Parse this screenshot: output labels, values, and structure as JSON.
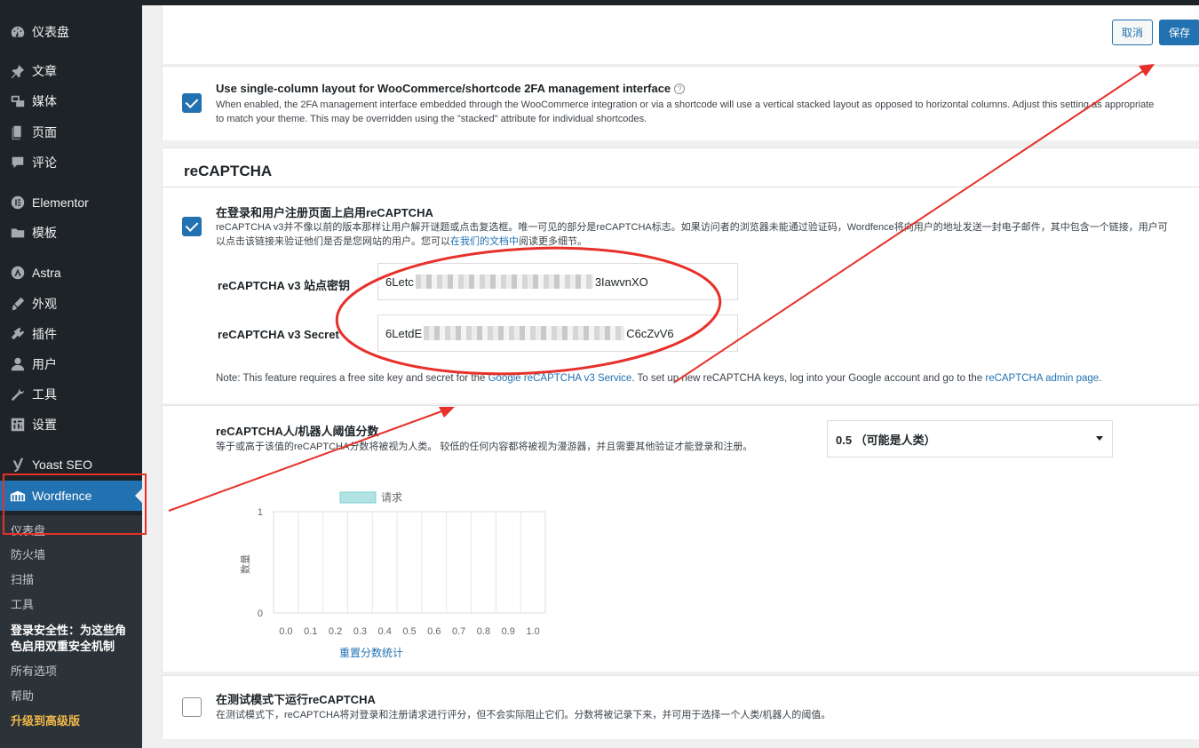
{
  "sidebar": {
    "items": [
      {
        "label": "仪表盘",
        "icon": "dashboard-icon"
      },
      {
        "label": "文章",
        "icon": "pin-icon"
      },
      {
        "label": "媒体",
        "icon": "media-icon"
      },
      {
        "label": "页面",
        "icon": "page-icon"
      },
      {
        "label": "评论",
        "icon": "comment-icon"
      },
      {
        "label": "Elementor",
        "icon": "elementor-icon"
      },
      {
        "label": "模板",
        "icon": "folder-icon"
      },
      {
        "label": "Astra",
        "icon": "astra-icon"
      },
      {
        "label": "外观",
        "icon": "brush-icon"
      },
      {
        "label": "插件",
        "icon": "plugin-icon"
      },
      {
        "label": "用户",
        "icon": "user-icon"
      },
      {
        "label": "工具",
        "icon": "wrench-icon"
      },
      {
        "label": "设置",
        "icon": "settings-icon"
      },
      {
        "label": "Yoast SEO",
        "icon": "yoast-icon"
      },
      {
        "label": "Wordfence",
        "icon": "wordfence-icon"
      }
    ],
    "submenu": [
      "仪表盘",
      "防火墙",
      "扫描",
      "工具",
      "登录安全性：为这些角色启用双重安全机制",
      "所有选项",
      "帮助",
      "升级到高级版"
    ]
  },
  "toolbar": {
    "cancel_label": "取消",
    "save_label": "保存"
  },
  "single_column": {
    "title": "Use single-column layout for WooCommerce/shortcode 2FA management interface",
    "help_glyph": "?",
    "desc": "When enabled, the 2FA management interface embedded through the WooCommerce integration or via a shortcode will use a vertical stacked layout as opposed to horizontal columns. Adjust this setting as appropriate to match your theme. This may be overridden using the \"stacked\" attribute for individual shortcodes.",
    "checked": true
  },
  "recaptcha": {
    "section_title": "reCAPTCHA",
    "enable_title": "在登录和用户注册页面上启用reCAPTCHA",
    "enable_desc_before": "reCAPTCHA v3并不像以前的版本那样让用户解开谜题或点击复选框。唯一可见的部分是reCAPTCHA标志。如果访问者的浏览器未能通过验证码，Wordfence将向用户的地址发送一封电子邮件，其中包含一个链接，用户可以点击该链接来验证他们是否是您网站的用户。您可以",
    "enable_desc_link": "在我们的文档中",
    "enable_desc_after": "阅读更多细节。",
    "site_key_label": "reCAPTCHA v3 站点密钥",
    "site_key_prefix": "6Letc",
    "site_key_suffix": "3IawvnXO",
    "secret_label": "reCAPTCHA v3 Secret",
    "secret_prefix": "6LetdE",
    "secret_suffix": "C6cZvV6",
    "note_before": "Note: This feature requires a free site key and secret for the ",
    "note_link1": "Google reCAPTCHA v3 Service",
    "note_middle": ". To set up new reCAPTCHA keys, log into your Google account and go to the ",
    "note_link2": "reCAPTCHA admin page",
    "note_after": ".",
    "threshold_title": "reCAPTCHA人/机器人阈值分数",
    "threshold_desc": "等于或高于该值的reCAPTCHA分数将被视为人类。 较低的任何内容都将被视为漫游器，并且需要其他验证才能登录和注册。",
    "threshold_value": "0.5 （可能是人类）",
    "reset_link": "重置分数统计",
    "test_title": "在测试模式下运行reCAPTCHA",
    "test_desc": "在测试模式下，reCAPTCHA将对登录和注册请求进行评分，但不会实际阻止它们。分数将被记录下来，并可用于选择一个人类/机器人的阈值。",
    "test_checked": false
  },
  "chart_data": {
    "type": "bar",
    "categories": [
      "0.0",
      "0.1",
      "0.2",
      "0.3",
      "0.4",
      "0.5",
      "0.6",
      "0.7",
      "0.8",
      "0.9",
      "1.0"
    ],
    "series": [
      {
        "name": "请求",
        "values": [
          0,
          0,
          0,
          0,
          0,
          0,
          0,
          0,
          0,
          0,
          0
        ],
        "color": "#b2e3e3"
      }
    ],
    "ylabel": "数量",
    "ylim": [
      0,
      1
    ],
    "yticks": [
      "0",
      "1"
    ],
    "legend": "top-center",
    "grid": true
  },
  "colors": {
    "accent": "#2271b1",
    "sidebar": "#1d2327",
    "annotation": "#e8302a"
  }
}
